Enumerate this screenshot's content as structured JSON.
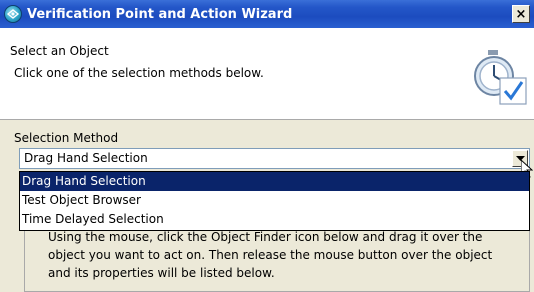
{
  "window": {
    "title": "Verification Point and Action Wizard",
    "close_label": "×"
  },
  "header": {
    "title": "Select an Object",
    "subtitle": "Click one of the selection methods below."
  },
  "selection": {
    "label": "Selection Method",
    "value": "Drag Hand Selection",
    "options": [
      "Drag Hand Selection",
      "Test Object Browser",
      "Time Delayed Selection"
    ],
    "selected_index": 0
  },
  "description": {
    "lines": [
      "Using the mouse, click the Object Finder icon below and drag it over the",
      "object you want to act on. Then release the mouse button over the object",
      "and its properties will be listed below."
    ]
  },
  "icons": {
    "app": "object-finder-icon",
    "wizard_graphic": "stopwatch-checkmark-icon",
    "cursor": "arrow-cursor-icon"
  },
  "colors": {
    "titlebar": "#1c4cbf",
    "selection_highlight": "#0a246a",
    "dialog_bg": "#ece9d8"
  }
}
